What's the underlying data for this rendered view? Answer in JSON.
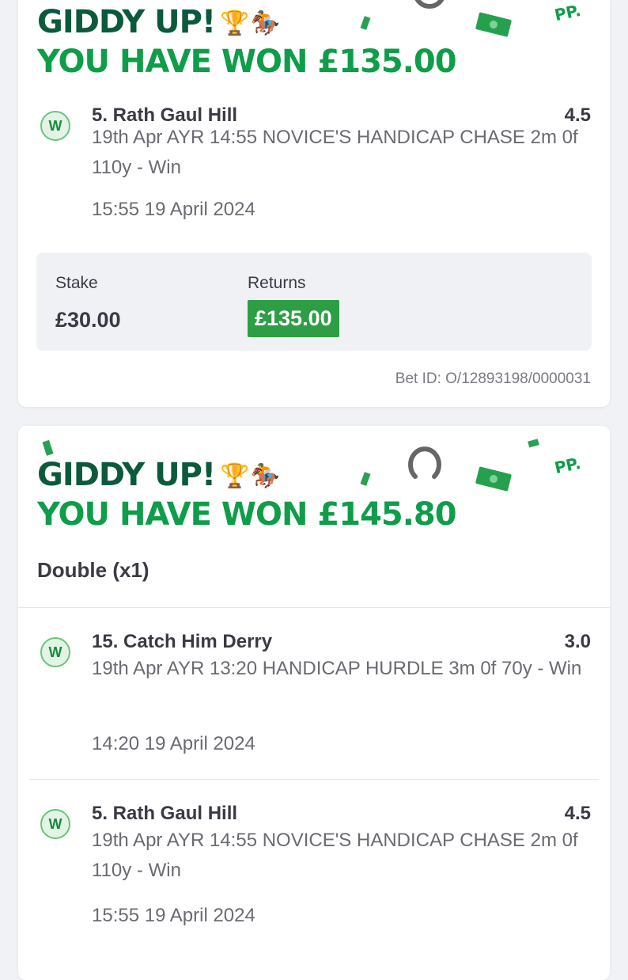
{
  "bets": [
    {
      "headline_1": "GIDDY UP!",
      "emoji_trophy": "🏆",
      "emoji_horse": "🏇",
      "headline_2": "YOU HAVE WON £135.00",
      "brand_mark": "PP.",
      "selections": [
        {
          "status": "W",
          "runner": "5. Rath Gaul Hill",
          "odds": "4.5",
          "description": "19th Apr AYR 14:55 NOVICE'S HANDICAP CHASE 2m 0f 110y - Win",
          "time": "15:55 19 April 2024"
        }
      ],
      "stake_label": "Stake",
      "stake_value": "£30.00",
      "returns_label": "Returns",
      "returns_value": "£135.00",
      "bet_id": "Bet ID: O/12893198/0000031"
    },
    {
      "headline_1": "GIDDY UP!",
      "emoji_trophy": "🏆",
      "emoji_horse": "🏇",
      "headline_2": "YOU HAVE WON £145.80",
      "brand_mark": "PP.",
      "bet_type": "Double (x1)",
      "selections": [
        {
          "status": "W",
          "runner": "15. Catch Him Derry",
          "odds": "3.0",
          "description": "19th Apr AYR 13:20 HANDICAP HURDLE 3m 0f 70y - Win",
          "time": "14:20 19 April 2024"
        },
        {
          "status": "W",
          "runner": "5. Rath Gaul Hill",
          "odds": "4.5",
          "description": "19th Apr AYR 14:55 NOVICE'S HANDICAP CHASE 2m 0f 110y - Win",
          "time": "15:55 19 April 2024"
        }
      ]
    }
  ],
  "colors": {
    "headline_dark": "#0b5a3c",
    "headline_green": "#0f9d4a",
    "returns_bg": "#2e9e46",
    "win_badge_bg": "#e3f4e6",
    "win_badge_border": "#6cc27d"
  }
}
